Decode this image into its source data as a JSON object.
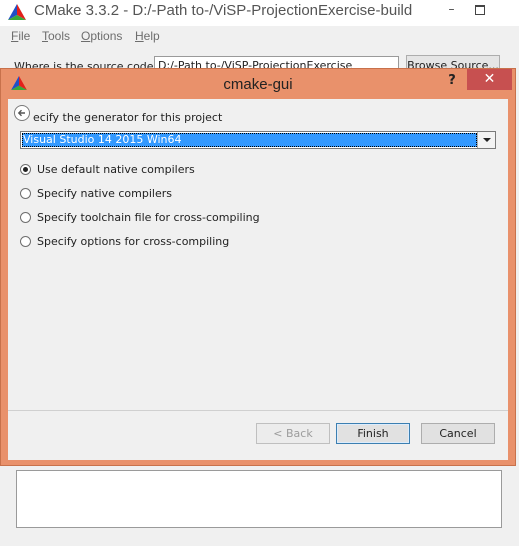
{
  "main_window": {
    "title": "CMake 3.3.2 - D:/-Path to-/ViSP-ProjectionExercise-build",
    "controls": {
      "minimize": "–"
    },
    "menu": [
      {
        "key": "F",
        "rest": "ile"
      },
      {
        "key": "T",
        "rest": "ools"
      },
      {
        "key": "O",
        "rest": "ptions"
      },
      {
        "key": "H",
        "rest": "elp"
      }
    ],
    "source_label": "Where is the source code:",
    "source_value": "D:/-Path to-/ViSP-ProjectionExercise",
    "browse_source_label": "Browse Source..."
  },
  "dialog": {
    "title": "cmake-gui",
    "help_label": "?",
    "close_label": "✕",
    "heading": "ecify the generator for this project",
    "generator_selected": "Visual Studio 14 2015 Win64",
    "options": [
      {
        "label": "Use default native compilers",
        "checked": true
      },
      {
        "label": "Specify native compilers",
        "checked": false
      },
      {
        "label": "Specify toolchain file for cross-compiling",
        "checked": false
      },
      {
        "label": "Specify options for cross-compiling",
        "checked": false
      }
    ],
    "buttons": {
      "back": "< Back",
      "finish": "Finish",
      "cancel": "Cancel"
    }
  },
  "colors": {
    "dialog_frame": "#e9916b",
    "close_button": "#c75050",
    "selection": "#3399ff"
  }
}
